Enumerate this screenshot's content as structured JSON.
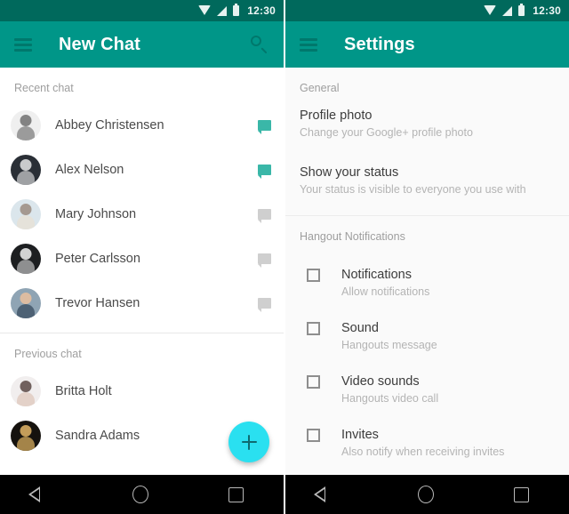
{
  "status_bar": {
    "time": "12:30",
    "icons": [
      "wifi-icon",
      "signal-icon",
      "battery-icon"
    ]
  },
  "left_screen": {
    "appbar": {
      "menu_icon": "hamburger-menu-icon",
      "title": "New Chat",
      "search_icon": "search-icon"
    },
    "sections": [
      {
        "label": "Recent chat",
        "rows": [
          {
            "name": "Abbey Christensen",
            "bubble": "active",
            "avatar_tone": "light"
          },
          {
            "name": "Alex Nelson",
            "bubble": "active",
            "avatar_tone": "dark"
          },
          {
            "name": "Mary Johnson",
            "bubble": "muted",
            "avatar_tone": "pale"
          },
          {
            "name": "Peter Carlsson",
            "bubble": "muted",
            "avatar_tone": "dark"
          },
          {
            "name": "Trevor Hansen",
            "bubble": "muted",
            "avatar_tone": "blue"
          }
        ]
      },
      {
        "label": "Previous chat",
        "rows": [
          {
            "name": "Britta Holt",
            "bubble": "none",
            "avatar_tone": "light"
          },
          {
            "name": "Sandra Adams",
            "bubble": "none",
            "avatar_tone": "darkest"
          }
        ]
      }
    ],
    "fab": {
      "icon": "plus-icon",
      "color": "#2ae0f0"
    }
  },
  "right_screen": {
    "appbar": {
      "menu_icon": "hamburger-menu-icon",
      "title": "Settings"
    },
    "general": {
      "label": "General",
      "items": [
        {
          "title": "Profile photo",
          "subtitle": "Change your Google+ profile photo"
        },
        {
          "title": "Show your status",
          "subtitle": "Your status is visible to everyone you use with"
        }
      ]
    },
    "notifications": {
      "label": "Hangout Notifications",
      "items": [
        {
          "title": "Notifications",
          "subtitle": "Allow notifications",
          "checked": false
        },
        {
          "title": "Sound",
          "subtitle": "Hangouts message",
          "checked": false
        },
        {
          "title": "Video sounds",
          "subtitle": "Hangouts video call",
          "checked": false
        },
        {
          "title": "Invites",
          "subtitle": "Also notify when receiving invites",
          "checked": false
        }
      ]
    }
  },
  "nav_bar": {
    "back": "back-triangle-icon",
    "home": "home-circle-icon",
    "recents": "recents-square-icon"
  },
  "colors": {
    "status_bar": "#00695c",
    "app_bar": "#009688",
    "accent_bubble": "#3ab7a8",
    "muted_bubble": "#cfcfcf",
    "fab": "#2ae0f0"
  }
}
